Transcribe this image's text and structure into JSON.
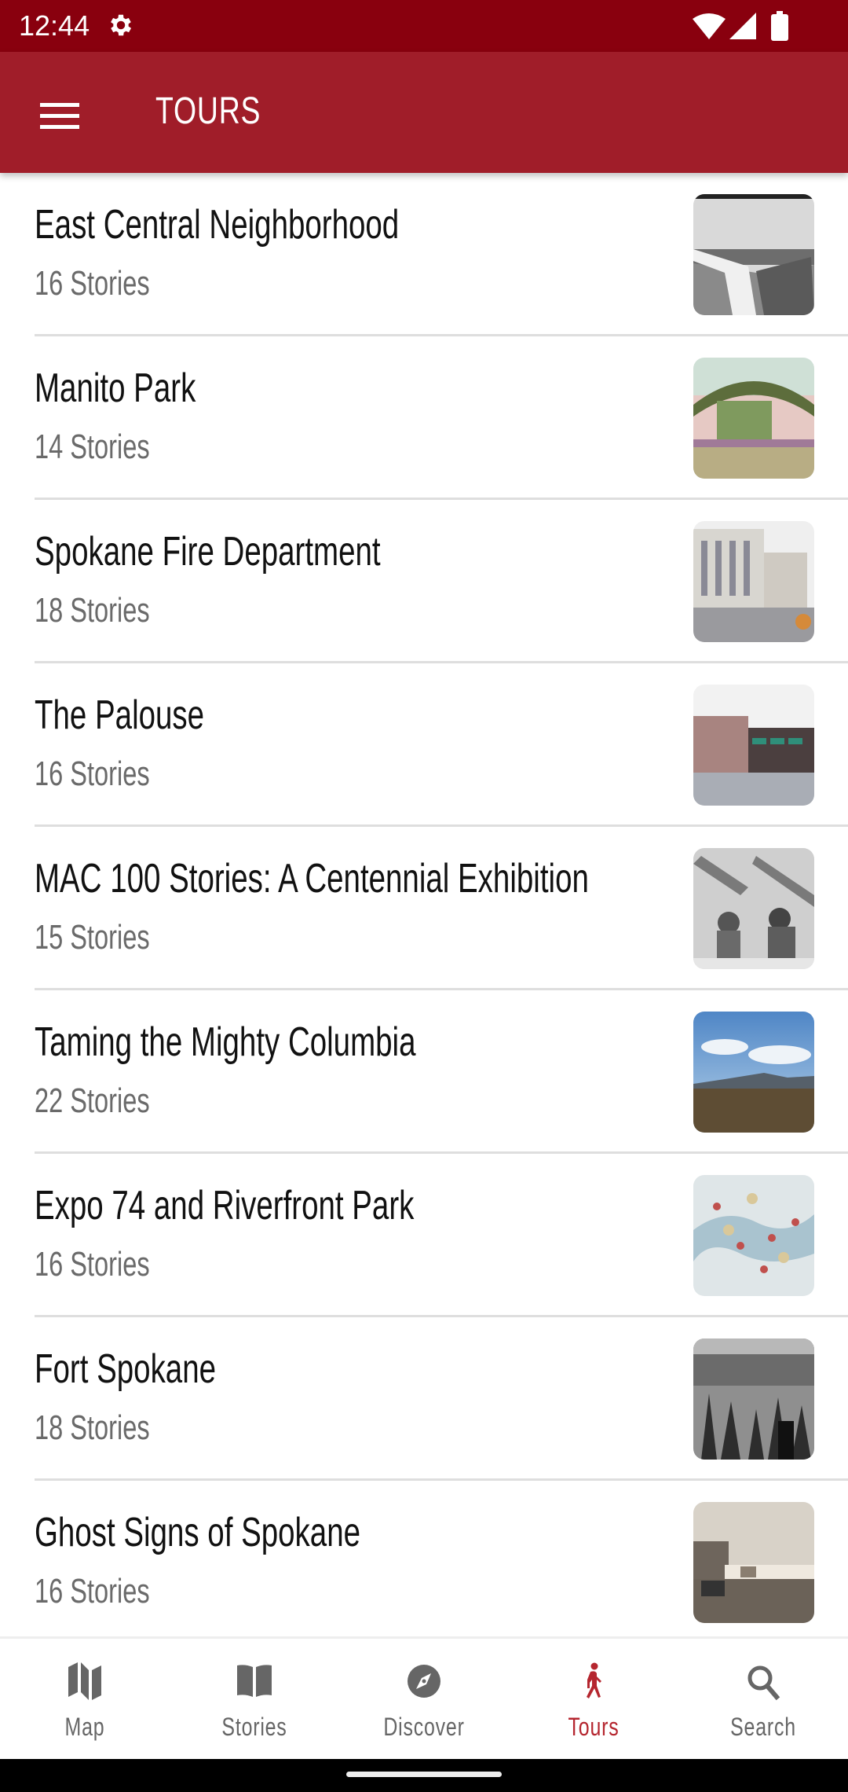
{
  "status_bar": {
    "time": "12:44",
    "icons": [
      "gear-icon",
      "wifi-icon",
      "signal-icon",
      "battery-icon"
    ]
  },
  "app_bar": {
    "menu_icon": "hamburger-menu-icon",
    "title": "TOURS"
  },
  "tours": [
    {
      "title": "East Central Neighborhood",
      "count": "16 Stories",
      "thumb": "bw-bridge"
    },
    {
      "title": "Manito Park",
      "count": "14 Stories",
      "thumb": "postcard-arch"
    },
    {
      "title": "Spokane Fire Department",
      "count": "18 Stories",
      "thumb": "building"
    },
    {
      "title": "The Palouse",
      "count": "16 Stories",
      "thumb": "street"
    },
    {
      "title": "MAC 100 Stories: A Centennial Exhibition",
      "count": "15 Stories",
      "thumb": "bw-sculpture"
    },
    {
      "title": "Taming the Mighty Columbia",
      "count": "22 Stories",
      "thumb": "landscape"
    },
    {
      "title": "Expo 74 and Riverfront Park",
      "count": "16 Stories",
      "thumb": "map"
    },
    {
      "title": "Fort Spokane",
      "count": "18 Stories",
      "thumb": "bw-forest"
    },
    {
      "title": "Ghost Signs of Spokane",
      "count": "16 Stories",
      "thumb": "sepia-street"
    }
  ],
  "bottom_nav": {
    "active": "Tours",
    "active_color": "#b5262f",
    "inactive_color": "#666666",
    "items": [
      {
        "label": "Map",
        "icon": "map-icon"
      },
      {
        "label": "Stories",
        "icon": "book-icon"
      },
      {
        "label": "Discover",
        "icon": "compass-icon"
      },
      {
        "label": "Tours",
        "icon": "walking-person-icon"
      },
      {
        "label": "Search",
        "icon": "search-icon"
      }
    ]
  },
  "colors": {
    "status_bar": "#89000e",
    "app_bar": "#a01d29",
    "accent": "#b5262f"
  }
}
